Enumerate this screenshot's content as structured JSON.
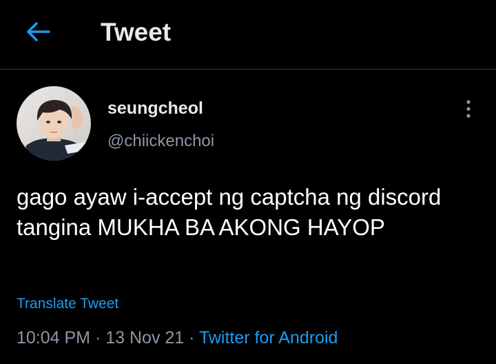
{
  "header": {
    "back_icon": "arrow-left-icon",
    "title": "Tweet"
  },
  "tweet": {
    "author": {
      "display_name": "seungcheol",
      "handle": "@chiickenchoi",
      "avatar": "profile-photo"
    },
    "more_icon": "more-vertical-icon",
    "text": "gago ayaw i-accept ng captcha ng discord tangina MUKHA BA AKONG HAYOP",
    "translate_label": "Translate Tweet",
    "time": "10:04 PM",
    "separator": " · ",
    "date": "13 Nov 21",
    "source": "Twitter for Android"
  },
  "colors": {
    "background": "#000000",
    "accent": "#1d9bf0",
    "secondary_text": "#8b98a5",
    "divider": "#2f3336"
  }
}
